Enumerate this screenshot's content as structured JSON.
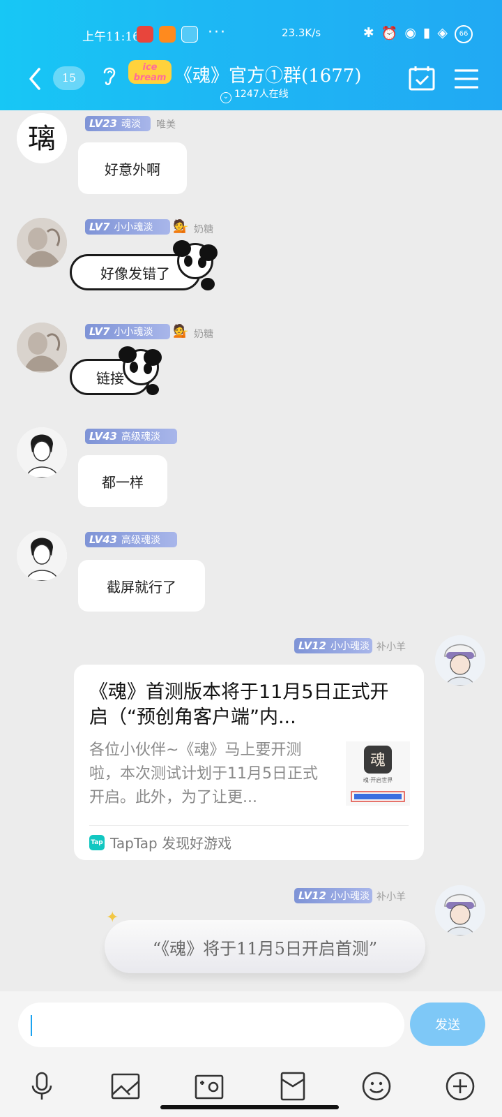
{
  "status": {
    "time": "上午11:16",
    "network_speed": "23.3K/s",
    "battery": "66"
  },
  "header": {
    "unread_count": "15",
    "logo_text": "ice bream",
    "group_title": "《魂》官方①群(1677)",
    "online_text": "1247人在线"
  },
  "messages": [
    {
      "level": "LV23",
      "title": "魂淡",
      "nick": "唯美",
      "text": "好意外啊",
      "avatar": "calligraphy"
    },
    {
      "level": "LV7",
      "title": "小小魂淡",
      "nick": "奶糖",
      "text": "好像发错了",
      "emoji": "💁",
      "avatar": "sketch"
    },
    {
      "level": "LV7",
      "title": "小小魂淡",
      "nick": "奶糖",
      "text": "链接",
      "emoji": "💁",
      "avatar": "sketch"
    },
    {
      "level": "LV43",
      "title": "高级魂淡",
      "nick": "",
      "text": "都一样",
      "avatar": "ink-portrait"
    },
    {
      "level": "LV43",
      "title": "高级魂淡",
      "nick": "",
      "text": "截屏就行了",
      "avatar": "ink-portrait"
    },
    {
      "level": "LV12",
      "title": "小小魂淡",
      "nick": "补小羊",
      "avatar": "anime-boy"
    },
    {
      "level": "LV12",
      "title": "小小魂淡",
      "nick": "补小羊",
      "avatar": "anime-boy"
    }
  ],
  "link_card": {
    "title": "《魂》首测版本将于11月5日正式开启（“预创角客户端”内...",
    "description": "各位小伙伴~《魂》马上要开测啦，本次测试计划于11月5日正式开启。此外，为了让更...",
    "thumb_caption": "魂·开启世界",
    "source_logo": "Tap",
    "source": "TapTap 发现好游戏"
  },
  "cloud_message": "“《魂》将于11月5日开启首测”",
  "input": {
    "placeholder": "",
    "send_label": "发送"
  },
  "colors": {
    "header_start": "#17c7f5",
    "header_end": "#21a9f3",
    "level_badge": "#8a9ddd",
    "send_button": "#7ec8f7"
  }
}
